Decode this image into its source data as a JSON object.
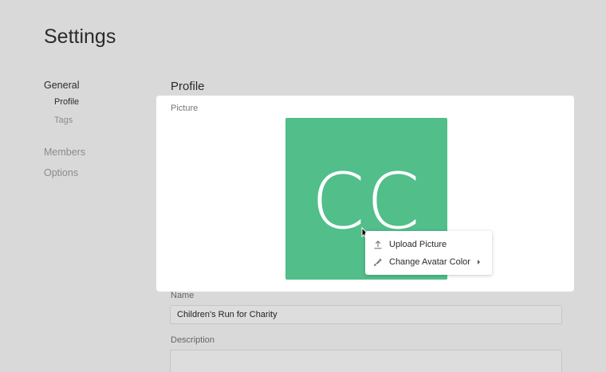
{
  "page": {
    "title": "Settings"
  },
  "nav": {
    "general": "General",
    "profile": "Profile",
    "tags": "Tags",
    "members": "Members",
    "options": "Options"
  },
  "profile": {
    "section_title": "Profile",
    "picture_label": "Picture",
    "avatar": {
      "initials": "CC",
      "color": "#52be8a"
    }
  },
  "context_menu": {
    "items": [
      {
        "label": "Upload Picture",
        "icon": "upload-icon"
      },
      {
        "label": "Change Avatar Color",
        "icon": "paint-brush-icon",
        "has_submenu": true
      }
    ]
  },
  "form": {
    "name_label": "Name",
    "name_value": "Children's Run for Charity",
    "description_label": "Description",
    "description_value": ""
  }
}
